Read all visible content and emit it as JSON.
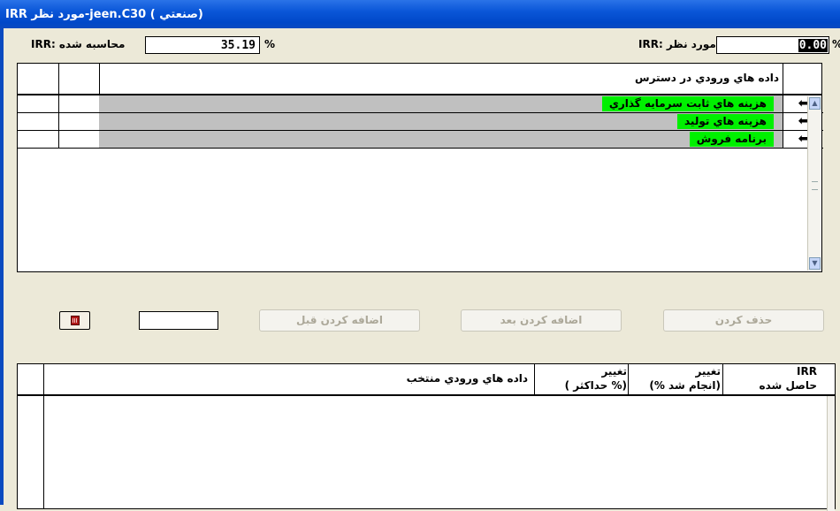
{
  "window": {
    "title": "IRR مورد نظر-jeen.C30 ( صنعتي)"
  },
  "target_irr": {
    "label": "IRR: مورد نظر",
    "value": "0.00",
    "unit": "%"
  },
  "computed_irr": {
    "label": "IRR: محاسبه شده",
    "value": "35.19",
    "unit": "%"
  },
  "available_inputs": {
    "header": "داده هاي ورودي در دسترس",
    "rows": [
      {
        "label": "هزينه هاي ثابت سرمايه گذاري",
        "arrow": "⬅"
      },
      {
        "label": "هزينه هاي توليد",
        "arrow": "⬅"
      },
      {
        "label": "برنامه فروش",
        "arrow": "⬅"
      }
    ]
  },
  "actions": {
    "calculator_icon": "calculator-icon",
    "add_before": "اضافه كردن قبل",
    "add_after": "اضافه كردن بعد",
    "delete": "حذف كردن"
  },
  "selected_inputs": {
    "col_selected": "داده هاي ورودي منتخب",
    "col_change_max_1": "تغيير",
    "col_change_max_2": "( حداكثر %)",
    "col_change_done_1": "تغيير",
    "col_change_done_2": "(% انجام شد)",
    "col_irr_1": "IRR",
    "col_irr_2": "حاصل شده"
  },
  "colors": {
    "highlight": "#00f000",
    "row_fill": "#c0c0c0",
    "titlebar": "#0a56d8",
    "background": "#ece9d8"
  }
}
